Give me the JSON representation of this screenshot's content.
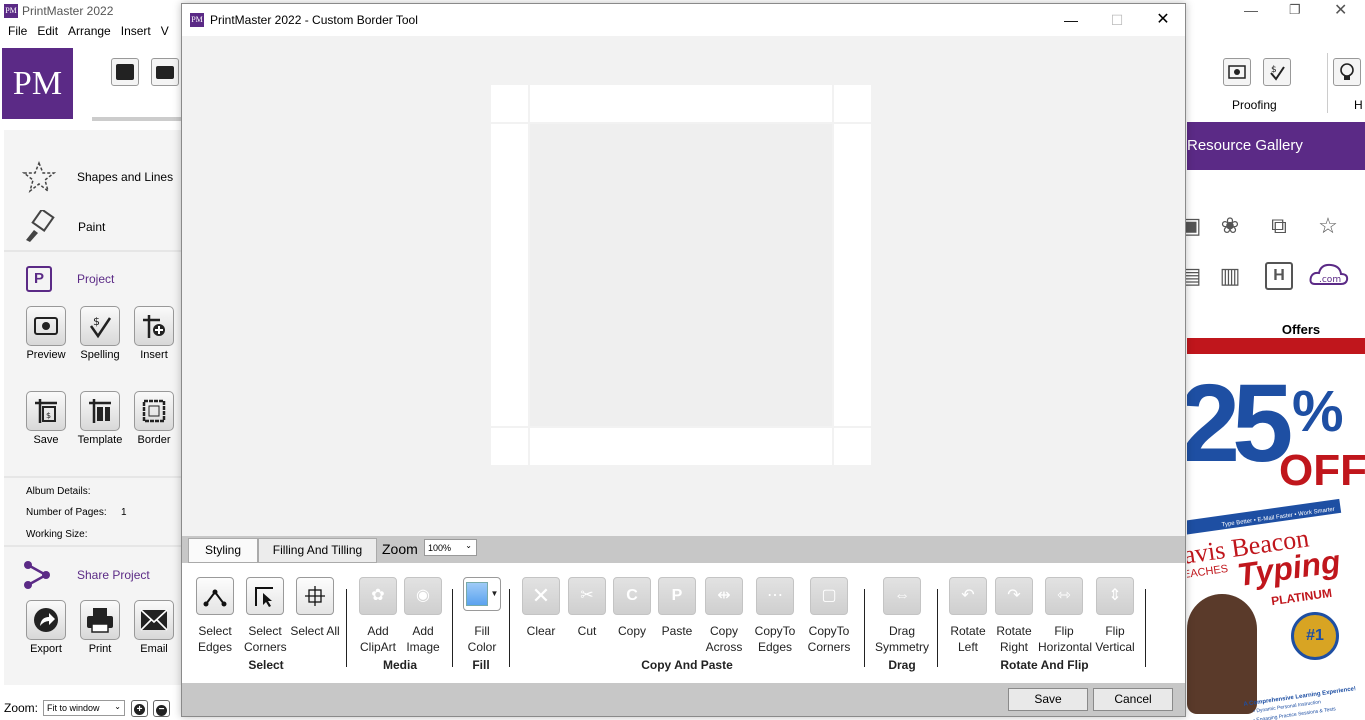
{
  "app": {
    "title": "PrintMaster 2022",
    "logo_text": "PM",
    "menu": [
      "File",
      "Edit",
      "Arrange",
      "Insert",
      "V"
    ]
  },
  "left_panel": {
    "rows": [
      {
        "label": "Shapes and Lines",
        "icon": "star-outline-icon"
      },
      {
        "label": "Paint",
        "icon": "paintbrush-icon"
      },
      {
        "label": "Project",
        "icon": "project-p-icon"
      }
    ],
    "project_buttons": [
      {
        "label": "Preview",
        "icon": "preview-icon"
      },
      {
        "label": "Spelling",
        "icon": "spelling-icon"
      },
      {
        "label": "Insert",
        "icon": "insert-icon"
      },
      {
        "label": "Save",
        "icon": "save-icon"
      },
      {
        "label": "Template",
        "icon": "template-icon"
      },
      {
        "label": "Border",
        "icon": "border-icon"
      }
    ],
    "album_details": "Album Details:",
    "number_of_pages_label": "Number of Pages:",
    "number_of_pages_value": "1",
    "working_size_label": "Working Size:",
    "share_label": "Share Project",
    "share_buttons": [
      {
        "label": "Export",
        "icon": "export-icon"
      },
      {
        "label": "Print",
        "icon": "printer-icon"
      },
      {
        "label": "Email",
        "icon": "email-icon"
      }
    ],
    "zoom_label": "Zoom:",
    "zoom_value": "Fit to window"
  },
  "right_panel": {
    "proofing_label": "Proofing",
    "partial_label": "H",
    "gallery_title": "Resource Gallery",
    "offers_title": "Offers",
    "ad": {
      "percent": "25",
      "percent_sign": "%",
      "off": "OFF",
      "tagline": "Type Better • E-Mail Faster • Work Smarter",
      "brand1": "avis Beacon",
      "teaches": "EACHES",
      "brand2": "Typing",
      "edition": "PLATINUM",
      "badge": "#1",
      "footer": "A Comprehensive Learning Experience!",
      "footer2": "• Dynamic Personal Instruction",
      "footer3": "• Engaging Practice Sessions & Tests"
    }
  },
  "dialog": {
    "title": "PrintMaster 2022 - Custom Border Tool",
    "tabs": [
      "Styling",
      "Filling And Tilling"
    ],
    "zoom_label": "Zoom",
    "zoom_value": "100%",
    "buttons": {
      "select_edges": "Select Edges",
      "select_corners": "Select Corners",
      "select_all": "Select All",
      "add_clipart": "Add ClipArt",
      "add_image": "Add Image",
      "fill_color": "Fill Color",
      "clear": "Clear",
      "cut": "Cut",
      "copy": "Copy",
      "paste": "Paste",
      "copy_across": "Copy Across",
      "copyto_edges": "CopyTo Edges",
      "copyto_corners": "CopyTo Corners",
      "drag_symmetry": "Drag Symmetry",
      "rotate_left": "Rotate Left",
      "rotate_right": "Rotate Right",
      "flip_horizontal": "Flip Horizontal",
      "flip_vertical": "Flip Vertical"
    },
    "groups": {
      "select": "Select",
      "media": "Media",
      "fill": "Fill",
      "copy_paste": "Copy And Paste",
      "drag": "Drag",
      "rotate_flip": "Rotate And Flip"
    },
    "save": "Save",
    "cancel": "Cancel"
  },
  "colors": {
    "brand_purple": "#5b2a86",
    "ad_blue": "#1e4fa3",
    "ad_red": "#c0161c",
    "fill_swatch": "#5aa2ef"
  }
}
